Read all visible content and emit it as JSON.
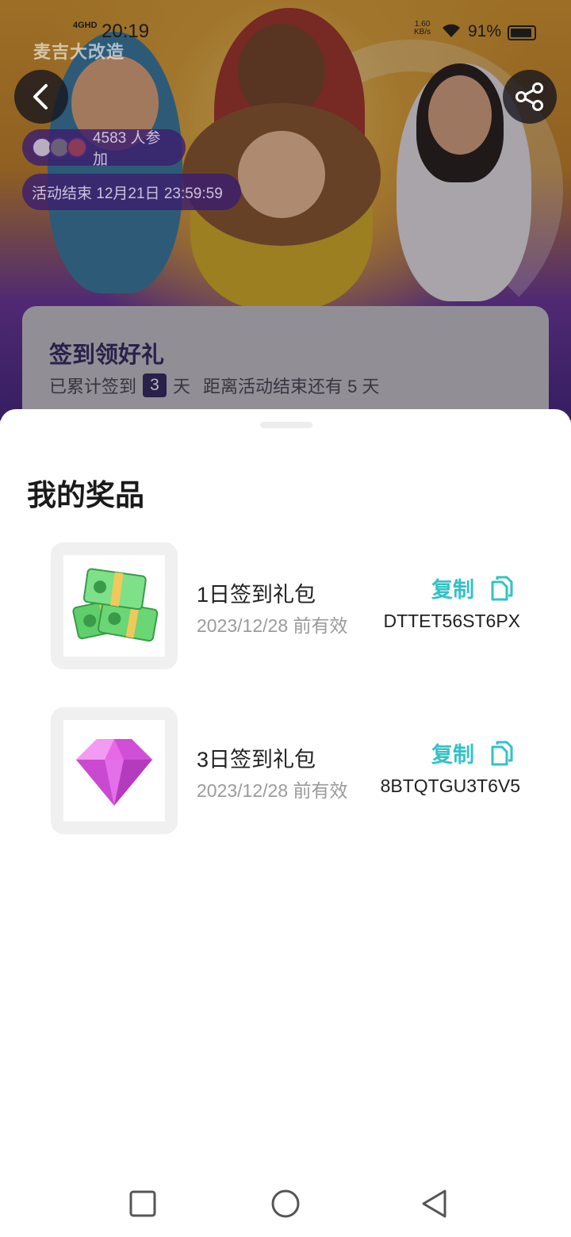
{
  "status_bar": {
    "network": "4GHD",
    "time": "20:19",
    "speed_value": "1.60",
    "speed_unit": "KB/s",
    "battery": "91%"
  },
  "banner": {
    "logo_text": "麦吉大改造",
    "participants": "4583 人参加",
    "end_time": "活动结束 12月21日 23:59:59"
  },
  "checkin": {
    "title": "签到领好礼",
    "prefix": "已累计签到",
    "days": "3",
    "suffix": "天",
    "remaining": "距离活动结束还有 5 天"
  },
  "sheet": {
    "title": "我的奖品",
    "prizes": [
      {
        "name": "1日签到礼包",
        "expiry": "2023/12/28 前有效",
        "code": "DTTET56ST6PX",
        "copy_label": "复制",
        "image": "cash-stack-icon"
      },
      {
        "name": "3日签到礼包",
        "expiry": "2023/12/28 前有效",
        "code": "8BTQTGU3T6V5",
        "copy_label": "复制",
        "image": "gem-icon"
      }
    ]
  },
  "colors": {
    "accent": "#33c2c7",
    "title_dark": "#1a1a1a",
    "muted": "#9b9b9b",
    "pill_bg": "#3c1e6e"
  }
}
